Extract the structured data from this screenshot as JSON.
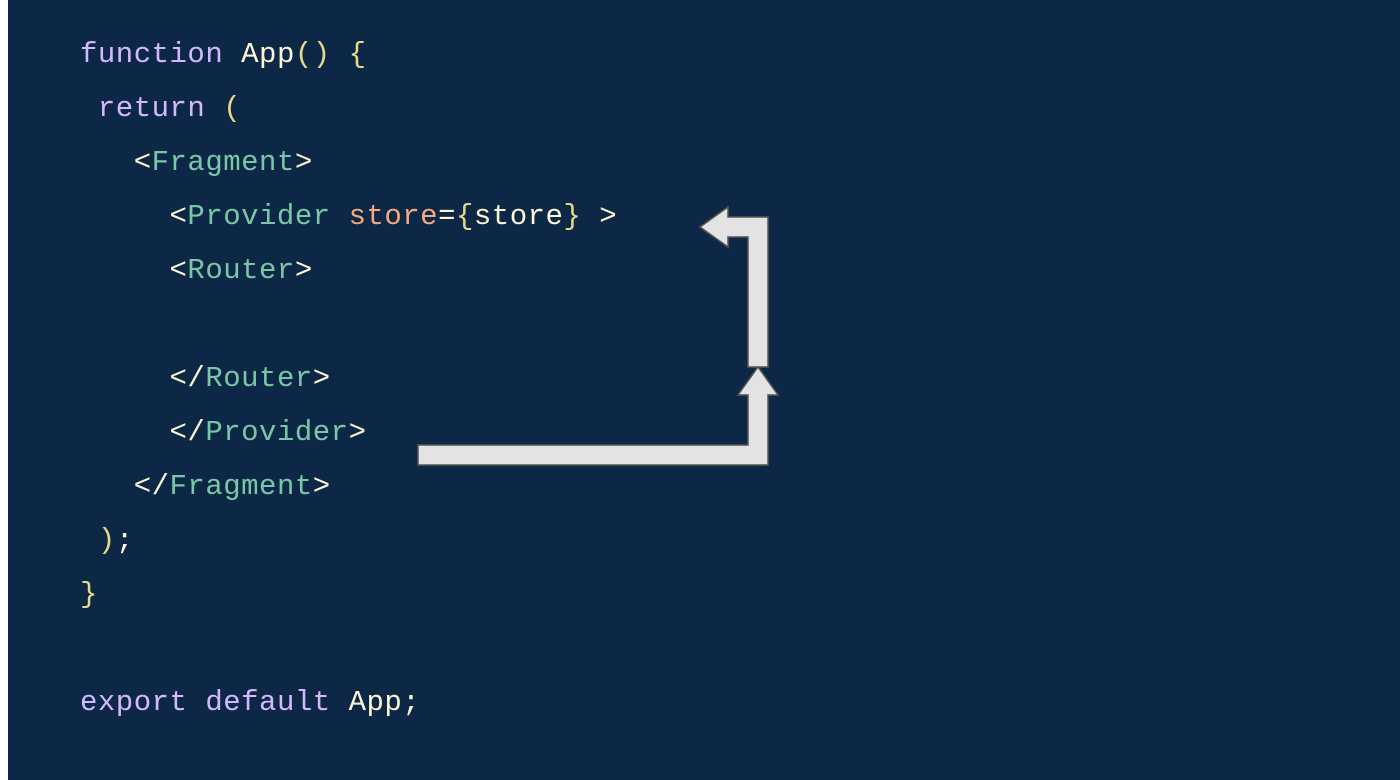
{
  "code": {
    "line1": {
      "kw_function": "function",
      "fn_name": "App",
      "parens": "()",
      "brace_open": " {"
    },
    "line2": {
      "kw_return": "return",
      "paren": " ("
    },
    "line3": {
      "open_bracket": "<",
      "tag": "Fragment",
      "close_bracket": ">"
    },
    "line4": {
      "open_bracket": "<",
      "tag": "Provider",
      "attr": "store",
      "equals": "=",
      "brace_l": "{",
      "value": "store",
      "brace_r": "}",
      "close_bracket": " >"
    },
    "line5": {
      "open_bracket": "<",
      "tag": "Router",
      "close_bracket": ">"
    },
    "line7": {
      "open_bracket": "</",
      "tag": "Router",
      "close_bracket": ">"
    },
    "line8": {
      "open_bracket": "</",
      "tag": "Provider",
      "close_bracket": ">"
    },
    "line9": {
      "open_bracket": "</",
      "tag": "Fragment",
      "close_bracket": ">"
    },
    "line10": {
      "paren": ")",
      "semi": ";"
    },
    "line11": {
      "brace_close": "}"
    },
    "line13": {
      "kw_export": "export",
      "kw_default": "default",
      "name": "App",
      "semi": ";"
    }
  }
}
